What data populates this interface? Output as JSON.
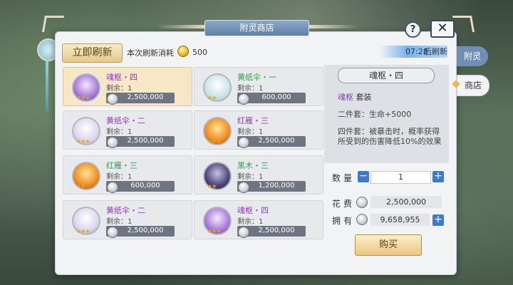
{
  "window": {
    "title": "附灵商店",
    "help_label": "?",
    "close_label": "✕"
  },
  "header": {
    "refresh_button": "立即刷新",
    "refresh_cost_label": "本次刷新消耗",
    "refresh_cost_value": "500",
    "timer_time": "07:28",
    "timer_label": "后刷新"
  },
  "items": [
    {
      "name": "魂枢・四",
      "stock_label": "剩余：",
      "stock": "1",
      "price": "2,500,000",
      "rarity": "purple",
      "selected": true,
      "icon": "purple-spirit-portrait"
    },
    {
      "name": "黄纸伞・一",
      "stock_label": "剩余：",
      "stock": "1",
      "price": "600,000",
      "rarity": "green",
      "selected": false,
      "icon": "white-spirit-portrait"
    },
    {
      "name": "黄纸伞・二",
      "stock_label": "剩余：",
      "stock": "1",
      "price": "2,500,000",
      "rarity": "purple",
      "selected": false,
      "icon": "white-spirit-portrait"
    },
    {
      "name": "红雁・三",
      "stock_label": "剩余：",
      "stock": "1",
      "price": "2,500,000",
      "rarity": "purple",
      "selected": false,
      "icon": "fire-bird-portrait"
    },
    {
      "name": "红雁・三",
      "stock_label": "剩余：",
      "stock": "1",
      "price": "600,000",
      "rarity": "green",
      "selected": false,
      "icon": "fire-bird-portrait"
    },
    {
      "name": "黑木・三",
      "stock_label": "剩余：",
      "stock": "1",
      "price": "1,200,000",
      "rarity": "green",
      "selected": false,
      "icon": "dark-bird-portrait"
    },
    {
      "name": "黄纸伞・二",
      "stock_label": "剩余：",
      "stock": "1",
      "price": "2,500,000",
      "rarity": "purple",
      "selected": false,
      "icon": "white-spirit-portrait"
    },
    {
      "name": "魂枢・四",
      "stock_label": "剩余：",
      "stock": "1",
      "price": "2,500,000",
      "rarity": "purple",
      "selected": false,
      "icon": "purple-spirit-portrait"
    }
  ],
  "detail": {
    "title": "魂枢・四",
    "set_name": "魂枢",
    "set_word": "套装",
    "two_piece": "二件套：生命+5000",
    "four_piece": "四件套：被暴击时，概率获得所受到的伤害降低10%的效果"
  },
  "purchase": {
    "qty_label": "数量",
    "qty_value": "1",
    "cost_label": "花费",
    "cost_value": "2,500,000",
    "own_label": "拥有",
    "own_value": "9,658,955",
    "buy_button": "购买"
  },
  "tabs": {
    "fuling": "附灵",
    "shop": "商店"
  },
  "colors": {
    "purple": "#8a3ab9",
    "green": "#2f9f53",
    "accent_blue": "#3d7bc8"
  }
}
